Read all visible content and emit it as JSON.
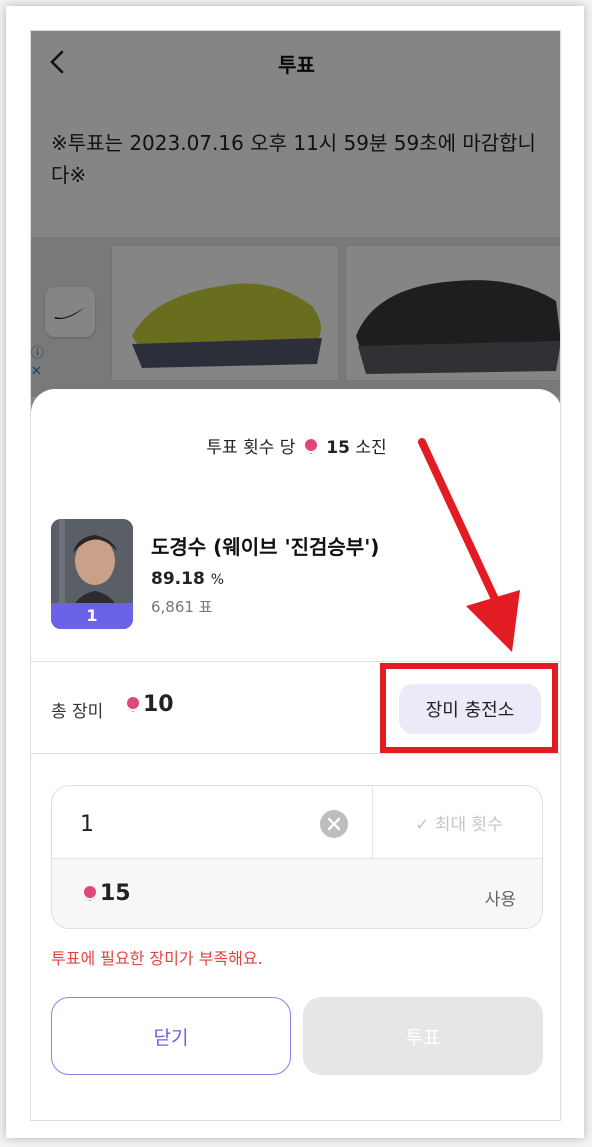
{
  "header": {
    "title": "투표"
  },
  "notice": "※투표는 2023.07.16 오후 11시 59분 59초에 마감합니다※",
  "sheet": {
    "cost_prefix": "투표 횟수 당",
    "cost_amount": "15",
    "cost_suffix": "소진",
    "candidate": {
      "name": "도경수 (웨이브 '진검승부')",
      "percent": "89.18",
      "percent_unit": "%",
      "votes": "6,861 표",
      "rank": "1"
    },
    "total_label": "총 장미",
    "total_value": "10",
    "charge_label": "장미 충전소",
    "quantity": "1",
    "max_label": "✓ 최대 횟수",
    "use_value": "15",
    "use_label": "사용",
    "error": "투표에 필요한 장미가 부족해요.",
    "close_label": "닫기",
    "vote_label": "투표"
  },
  "colors": {
    "accent": "#6b62e8",
    "error": "#e04545",
    "annotation": "#e31b23"
  }
}
